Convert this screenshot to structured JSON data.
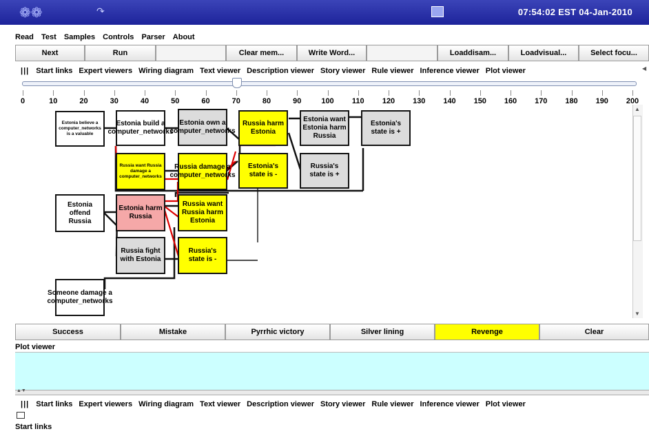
{
  "topbar": {
    "clock": "07:54:02 EST 04-Jan-2010",
    "icons": [
      "paw-icon",
      "arrow-icon",
      "system-icon"
    ]
  },
  "menubar": {
    "items": [
      "Read",
      "Test",
      "Samples",
      "Controls",
      "Parser",
      "About"
    ]
  },
  "toolbar_buttons": [
    "Next",
    "Run",
    "",
    "Clear mem...",
    "Write Word...",
    "",
    "Loaddisam...",
    "Loadvisual...",
    "Select focu..."
  ],
  "tabs": [
    "Start links",
    "Expert viewers",
    "Wiring diagram",
    "Text viewer",
    "Description viewer",
    "Story viewer",
    "Rule viewer",
    "Inference viewer",
    "Plot viewer"
  ],
  "slider": {
    "value": 70,
    "min": 0,
    "max": 200,
    "tick_labels": [
      "0",
      "10",
      "20",
      "30",
      "40",
      "50",
      "60",
      "70",
      "80",
      "90",
      "100",
      "110",
      "120",
      "130",
      "140",
      "150",
      "160",
      "170",
      "180",
      "190",
      "200"
    ]
  },
  "nodes": [
    {
      "id": "n1",
      "text": "Estonia believe a computer_networks is a valuable",
      "color": "white",
      "small": true
    },
    {
      "id": "n2",
      "text": "Estonia build a computer_networks",
      "color": "white"
    },
    {
      "id": "n3",
      "text": "Estonia own a computer_networks",
      "color": "gray"
    },
    {
      "id": "n4",
      "text": "Russia harm Estonia",
      "color": "yellow"
    },
    {
      "id": "n5",
      "text": "Estonia want Estonia harm Russia",
      "color": "gray"
    },
    {
      "id": "n6",
      "text": "Estonia's state is +",
      "color": "gray"
    },
    {
      "id": "n7",
      "text": "Russia want Russia damage a computer_networks",
      "color": "yellow",
      "small": true
    },
    {
      "id": "n8",
      "text": "Russia damage a computer_networks",
      "color": "yellow"
    },
    {
      "id": "n9",
      "text": "Estonia's state is -",
      "color": "yellow"
    },
    {
      "id": "n10",
      "text": "Russia's state is +",
      "color": "gray"
    },
    {
      "id": "n11",
      "text": "Estonia offend Russia",
      "color": "white"
    },
    {
      "id": "n12",
      "text": "Estonia harm Russia",
      "color": "pink"
    },
    {
      "id": "n13",
      "text": "Russia want Russia harm Estonia",
      "color": "yellow"
    },
    {
      "id": "n14",
      "text": "Russia fight with Estonia",
      "color": "gray"
    },
    {
      "id": "n15",
      "text": "Russia's state is -",
      "color": "yellow"
    },
    {
      "id": "n16",
      "text": "Someone damage a computer_networks",
      "color": "white"
    }
  ],
  "outcome_buttons": [
    {
      "label": "Success",
      "active": false
    },
    {
      "label": "Mistake",
      "active": false
    },
    {
      "label": "Pyrrhic victory",
      "active": false
    },
    {
      "label": "Silver lining",
      "active": false
    },
    {
      "label": "Revenge",
      "active": true
    },
    {
      "label": "Clear",
      "active": false
    }
  ],
  "plot_viewer_label": "Plot viewer",
  "bottom_tabs": [
    "Start links",
    "Expert viewers",
    "Wiring diagram",
    "Text viewer",
    "Description viewer",
    "Story viewer",
    "Rule viewer",
    "Inference viewer",
    "Plot viewer"
  ],
  "start_links_label": "Start links",
  "colors": {
    "yellow": "#ffff00",
    "gray": "#dcdcdc",
    "pink": "#f5a8a8",
    "plot_bg": "#ccffff",
    "link_red": "#dd0000"
  }
}
